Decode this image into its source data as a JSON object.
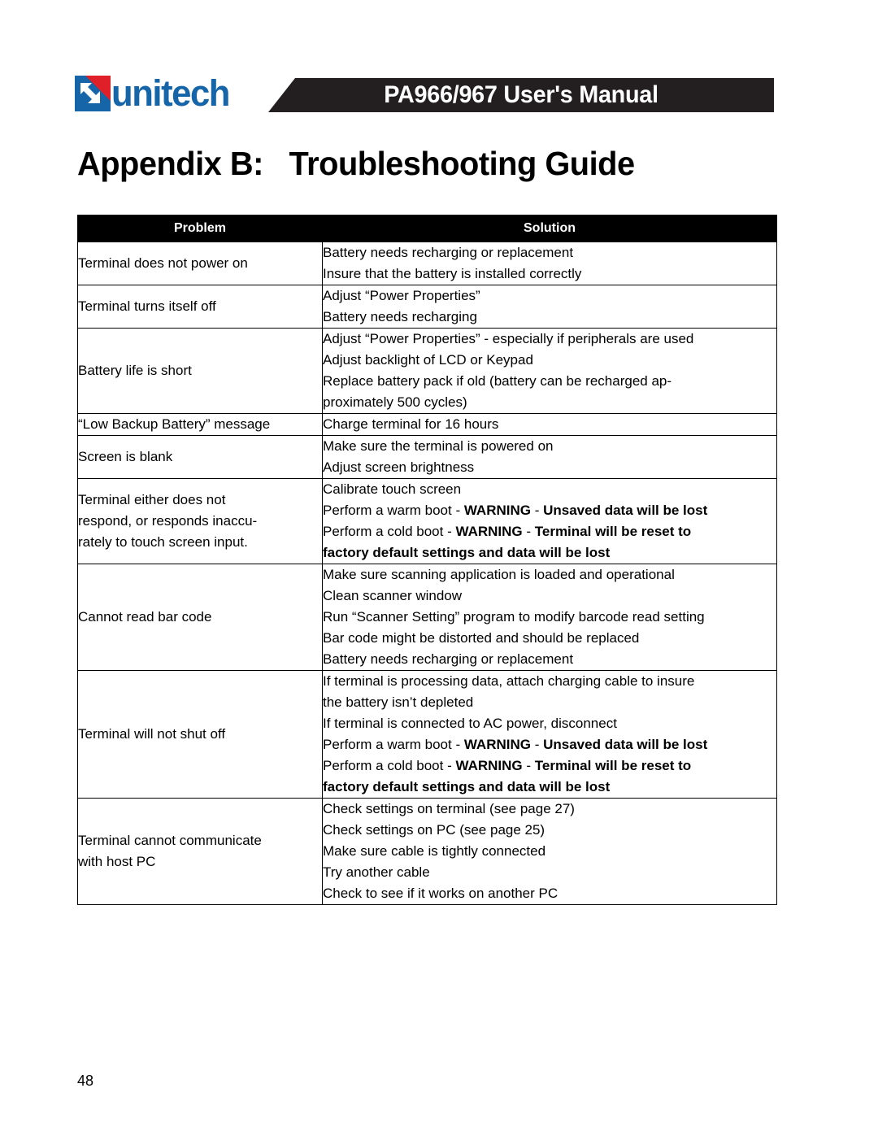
{
  "header": {
    "logo_word": "unitech",
    "logo_mark_icon": "unitech-arrow-mark-icon",
    "banner_title": "PA966/967 User's Manual"
  },
  "chapter": {
    "title": "Appendix B:   Troubleshooting Guide"
  },
  "table": {
    "columns": [
      "Problem",
      "Solution"
    ],
    "rows": [
      {
        "problem": [
          "Terminal does not power on"
        ],
        "solution": [
          [
            {
              "text": "Battery needs recharging or replacement",
              "bold": false
            }
          ],
          [
            {
              "text": "Insure that the battery is installed correctly",
              "bold": false
            }
          ]
        ]
      },
      {
        "problem": [
          "Terminal turns itself off"
        ],
        "solution": [
          [
            {
              "text": "Adjust “Power Properties”",
              "bold": false
            }
          ],
          [
            {
              "text": "Battery needs recharging",
              "bold": false
            }
          ]
        ]
      },
      {
        "problem": [
          "Battery life is short"
        ],
        "solution": [
          [
            {
              "text": "Adjust “Power Properties” - especially if peripherals are used",
              "bold": false
            }
          ],
          [
            {
              "text": "Adjust backlight of LCD or Keypad",
              "bold": false
            }
          ],
          [
            {
              "text": "Replace battery pack if old (battery can be recharged ap-",
              "bold": false
            }
          ],
          [
            {
              "text": "proximately 500 cycles)",
              "bold": false
            }
          ]
        ]
      },
      {
        "problem": [
          "“Low Backup Battery” message"
        ],
        "solution": [
          [
            {
              "text": "Charge terminal for 16 hours",
              "bold": false
            }
          ]
        ]
      },
      {
        "problem": [
          "Screen is blank"
        ],
        "solution": [
          [
            {
              "text": "Make sure the terminal is powered on",
              "bold": false
            }
          ],
          [
            {
              "text": "Adjust screen brightness",
              "bold": false
            }
          ]
        ]
      },
      {
        "problem": [
          "Terminal either does not",
          "respond, or responds inaccu-",
          "rately to touch screen input."
        ],
        "solution": [
          [
            {
              "text": "Calibrate touch screen",
              "bold": false
            }
          ],
          [
            {
              "text": "Perform a warm boot - ",
              "bold": false
            },
            {
              "text": "WARNING",
              "bold": true
            },
            {
              "text": " - ",
              "bold": false
            },
            {
              "text": "Unsaved data will be lost",
              "bold": true
            }
          ],
          [
            {
              "text": "Perform a cold boot - ",
              "bold": false
            },
            {
              "text": "WARNING",
              "bold": true
            },
            {
              "text": " - ",
              "bold": false
            },
            {
              "text": "Terminal will be reset to",
              "bold": true
            }
          ],
          [
            {
              "text": "factory default settings and data will be lost",
              "bold": true
            }
          ]
        ]
      },
      {
        "problem": [
          "Cannot read bar code"
        ],
        "solution": [
          [
            {
              "text": "Make sure scanning application is loaded and operational",
              "bold": false
            }
          ],
          [
            {
              "text": "Clean scanner window",
              "bold": false
            }
          ],
          [
            {
              "text": "Run “Scanner Setting” program to modify barcode read setting",
              "bold": false
            }
          ],
          [
            {
              "text": "Bar code might be distorted and should be replaced",
              "bold": false
            }
          ],
          [
            {
              "text": "Battery needs recharging or replacement",
              "bold": false
            }
          ]
        ]
      },
      {
        "problem": [
          "Terminal will not shut off"
        ],
        "solution": [
          [
            {
              "text": "If terminal is processing data, attach charging cable to insure",
              "bold": false
            }
          ],
          [
            {
              "text": "the battery isn’t depleted",
              "bold": false
            }
          ],
          [
            {
              "text": "If terminal is connected to AC power, disconnect",
              "bold": false
            }
          ],
          [
            {
              "text": "Perform a warm boot - ",
              "bold": false
            },
            {
              "text": "WARNING",
              "bold": true
            },
            {
              "text": " - ",
              "bold": false
            },
            {
              "text": "Unsaved data will be lost",
              "bold": true
            }
          ],
          [
            {
              "text": "Perform a cold boot - ",
              "bold": false
            },
            {
              "text": "WARNING",
              "bold": true
            },
            {
              "text": " - ",
              "bold": false
            },
            {
              "text": "Terminal will be reset to",
              "bold": true
            }
          ],
          [
            {
              "text": "factory default settings and data will be lost",
              "bold": true
            }
          ]
        ]
      },
      {
        "problem": [
          "Terminal cannot communicate",
          "with host PC"
        ],
        "solution": [
          [
            {
              "text": "Check settings on terminal (see page 27)",
              "bold": false
            }
          ],
          [
            {
              "text": "Check settings on PC (see page 25)",
              "bold": false
            }
          ],
          [
            {
              "text": "Make sure cable is tightly connected",
              "bold": false
            }
          ],
          [
            {
              "text": "Try another cable",
              "bold": false
            }
          ],
          [
            {
              "text": "Check to see if it works on another PC",
              "bold": false
            }
          ]
        ]
      }
    ]
  },
  "footer": {
    "page_number": "48"
  },
  "colors": {
    "logo_blue": "#1565A8",
    "logo_red": "#E02028",
    "banner_black": "#231f20"
  }
}
